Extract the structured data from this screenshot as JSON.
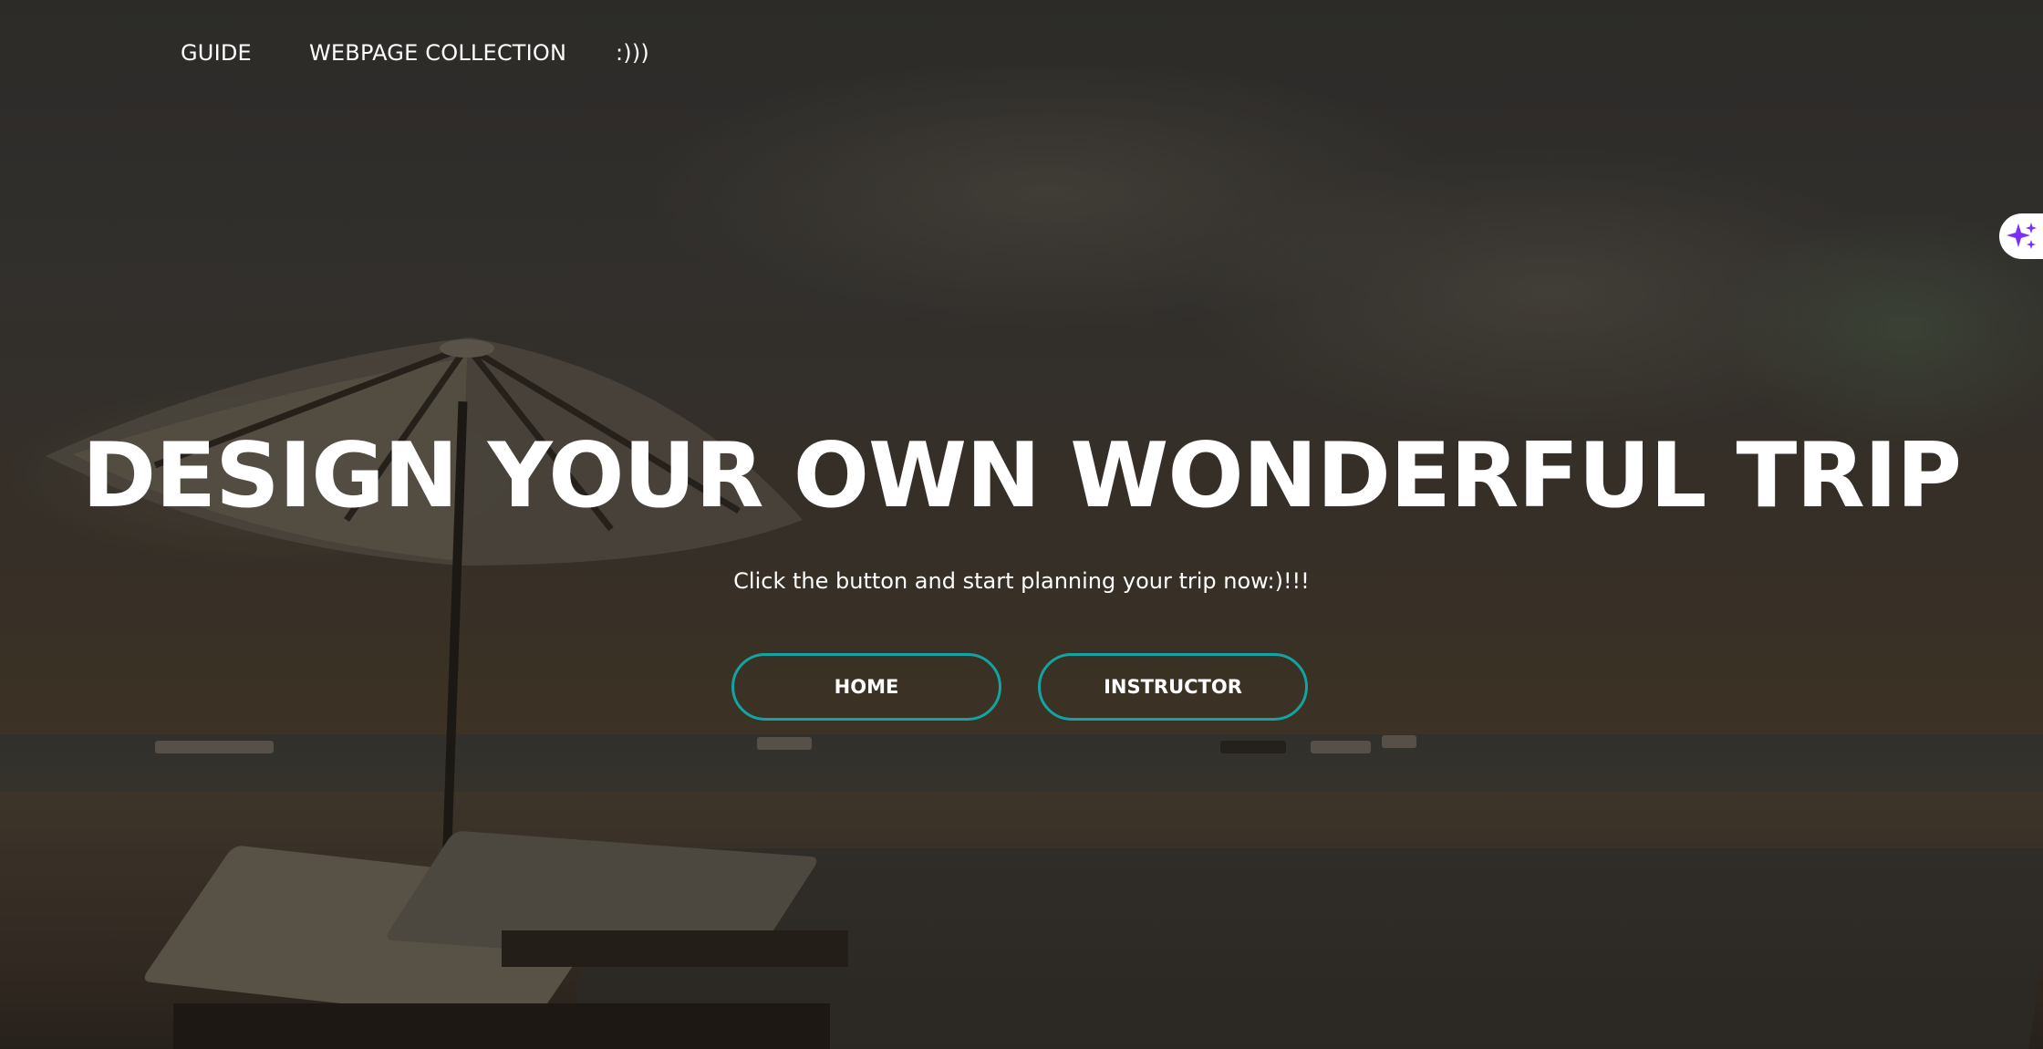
{
  "nav": {
    "items": [
      {
        "label": "GUIDE"
      },
      {
        "label": "WEBPAGE COLLECTION"
      },
      {
        "label": ":)))"
      }
    ]
  },
  "hero": {
    "title": "DESIGN YOUR OWN WONDERFUL TRIP",
    "subtitle": "Click the button and start planning your trip now:)!!!",
    "buttons": {
      "home_label": "HOME",
      "instructor_label": "INSTRUCTOR"
    }
  },
  "colors": {
    "button_border": "#14a3a3",
    "text": "#ffffff",
    "sparkle": "#7b2ff7"
  },
  "icons": {
    "side_tab": "sparkle-icon"
  }
}
